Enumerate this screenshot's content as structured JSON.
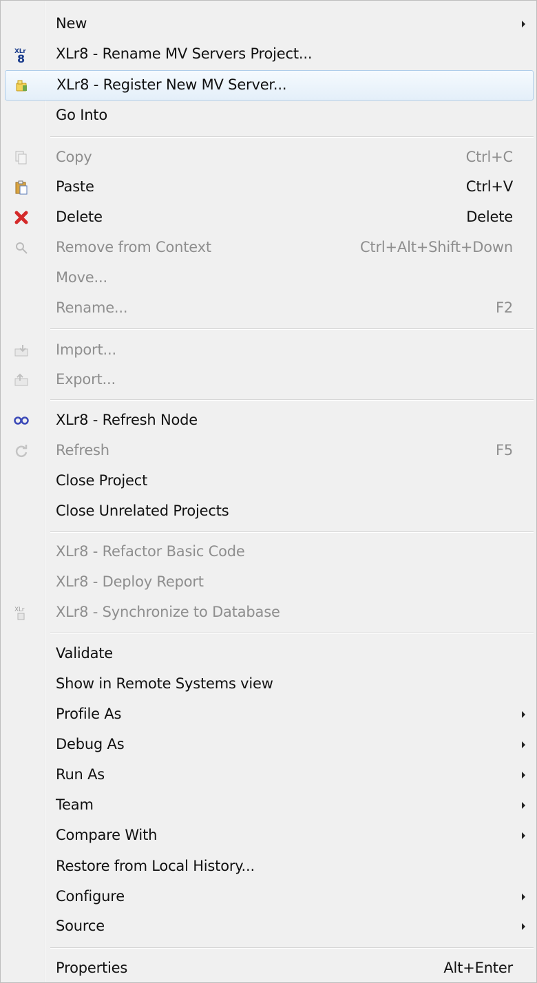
{
  "menu": {
    "items": [
      {
        "label": "New",
        "submenu": true
      },
      {
        "label": "XLr8 - Rename MV Servers Project...",
        "icon": "xlr8-icon"
      },
      {
        "label": "XLr8 - Register New MV Server...",
        "icon": "register-server-icon",
        "highlighted": true
      },
      {
        "label": "Go Into"
      },
      {
        "label": "Copy",
        "accelerator": "Ctrl+C",
        "disabled": true,
        "icon": "copy-icon"
      },
      {
        "label": "Paste",
        "accelerator": "Ctrl+V",
        "icon": "paste-icon"
      },
      {
        "label": "Delete",
        "accelerator": "Delete",
        "icon": "delete-icon"
      },
      {
        "label": "Remove from Context",
        "accelerator": "Ctrl+Alt+Shift+Down",
        "disabled": true,
        "icon": "remove-context-icon"
      },
      {
        "label": "Move...",
        "disabled": true
      },
      {
        "label": "Rename...",
        "accelerator": "F2",
        "disabled": true
      },
      {
        "label": "Import...",
        "disabled": true,
        "icon": "import-icon"
      },
      {
        "label": "Export...",
        "disabled": true,
        "icon": "export-icon"
      },
      {
        "label": "XLr8 - Refresh Node",
        "icon": "refresh-node-icon"
      },
      {
        "label": "Refresh",
        "accelerator": "F5",
        "disabled": true,
        "icon": "refresh-icon"
      },
      {
        "label": "Close Project"
      },
      {
        "label": "Close Unrelated Projects"
      },
      {
        "label": "XLr8 - Refactor Basic Code",
        "disabled": true
      },
      {
        "label": "XLr8 - Deploy Report",
        "disabled": true
      },
      {
        "label": "XLr8 - Synchronize to Database",
        "disabled": true,
        "icon": "xlr8-sync-icon"
      },
      {
        "label": "Validate"
      },
      {
        "label": "Show in Remote Systems view"
      },
      {
        "label": "Profile As",
        "submenu": true
      },
      {
        "label": "Debug As",
        "submenu": true
      },
      {
        "label": "Run As",
        "submenu": true
      },
      {
        "label": "Team",
        "submenu": true
      },
      {
        "label": "Compare With",
        "submenu": true
      },
      {
        "label": "Restore from Local History..."
      },
      {
        "label": "Configure",
        "submenu": true
      },
      {
        "label": "Source",
        "submenu": true
      },
      {
        "label": "Properties",
        "accelerator": "Alt+Enter"
      }
    ],
    "colors": {
      "background": "#f0f0f0",
      "highlight": "#e4eff9",
      "highlight_border": "#aecdea",
      "disabled_text": "#8e8e8e",
      "enabled_text": "#111111"
    }
  }
}
